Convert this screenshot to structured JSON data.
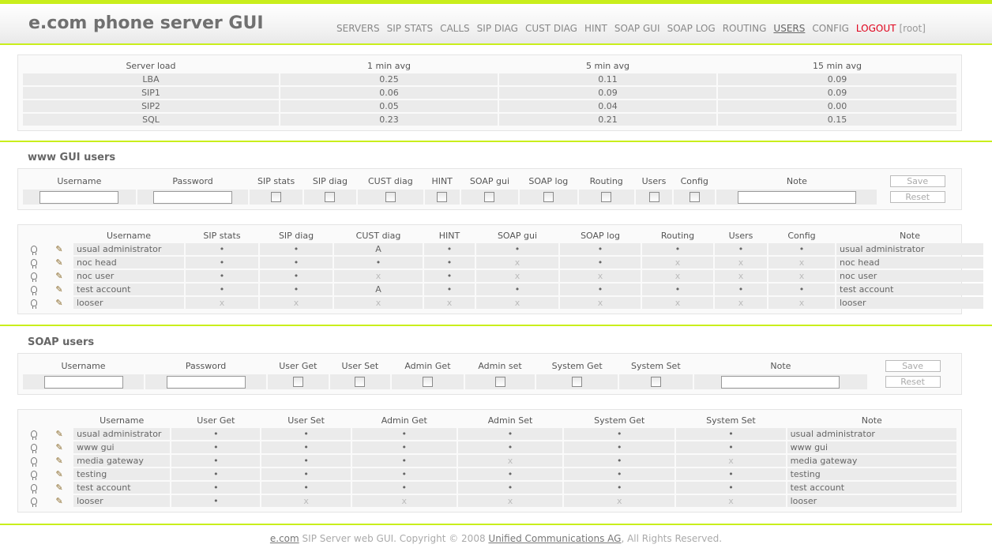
{
  "app": {
    "title": "e.com phone server GUI"
  },
  "nav": {
    "items": [
      "SERVERS",
      "SIP STATS",
      "CALLS",
      "SIP DIAG",
      "CUST DIAG",
      "HINT",
      "SOAP GUI",
      "SOAP LOG",
      "ROUTING",
      "USERS",
      "CONFIG"
    ],
    "active": "USERS",
    "logout": "LOGOUT",
    "user": "[root]"
  },
  "server_load": {
    "headers": [
      "Server load",
      "1 min avg",
      "5 min avg",
      "15 min avg"
    ],
    "rows": [
      [
        "LBA",
        "0.25",
        "0.11",
        "0.09"
      ],
      [
        "SIP1",
        "0.06",
        "0.09",
        "0.09"
      ],
      [
        "SIP2",
        "0.05",
        "0.04",
        "0.00"
      ],
      [
        "SQL",
        "0.23",
        "0.21",
        "0.15"
      ]
    ]
  },
  "www_users": {
    "title": "www GUI users",
    "form_headers": [
      "Username",
      "Password",
      "SIP stats",
      "SIP diag",
      "CUST diag",
      "HINT",
      "SOAP gui",
      "SOAP log",
      "Routing",
      "Users",
      "Config",
      "Note"
    ],
    "save_label": "Save",
    "reset_label": "Reset",
    "list_headers": [
      "Username",
      "SIP stats",
      "SIP diag",
      "CUST diag",
      "HINT",
      "SOAP gui",
      "SOAP log",
      "Routing",
      "Users",
      "Config",
      "Note"
    ],
    "rows": [
      [
        "usual administrator",
        "•",
        "•",
        "A",
        "•",
        "•",
        "•",
        "•",
        "•",
        "•",
        "usual administrator"
      ],
      [
        "noc head",
        "•",
        "•",
        "•",
        "•",
        "x",
        "•",
        "x",
        "x",
        "x",
        "noc head"
      ],
      [
        "noc user",
        "•",
        "•",
        "x",
        "•",
        "x",
        "x",
        "x",
        "x",
        "x",
        "noc user"
      ],
      [
        "test account",
        "•",
        "•",
        "A",
        "•",
        "•",
        "•",
        "•",
        "•",
        "•",
        "test account"
      ],
      [
        "looser",
        "x",
        "x",
        "x",
        "x",
        "x",
        "x",
        "x",
        "x",
        "x",
        "looser"
      ]
    ]
  },
  "soap_users": {
    "title": "SOAP users",
    "form_headers": [
      "Username",
      "Password",
      "User Get",
      "User Set",
      "Admin Get",
      "Admin set",
      "System Get",
      "System Set",
      "Note"
    ],
    "save_label": "Save",
    "reset_label": "Reset",
    "list_headers": [
      "Username",
      "User Get",
      "User Set",
      "Admin Get",
      "Admin Set",
      "System Get",
      "System Set",
      "Note"
    ],
    "rows": [
      [
        "usual administrator",
        "•",
        "•",
        "•",
        "•",
        "•",
        "•",
        "usual administrator"
      ],
      [
        "www gui",
        "•",
        "•",
        "•",
        "•",
        "•",
        "•",
        "www gui"
      ],
      [
        "media gateway",
        "•",
        "•",
        "•",
        "x",
        "•",
        "x",
        "media gateway"
      ],
      [
        "testing",
        "•",
        "•",
        "•",
        "•",
        "•",
        "•",
        "testing"
      ],
      [
        "test account",
        "•",
        "•",
        "•",
        "•",
        "•",
        "•",
        "test account"
      ],
      [
        "looser",
        "•",
        "x",
        "x",
        "x",
        "x",
        "x",
        "looser"
      ]
    ]
  },
  "footer": {
    "link1": "e.com",
    "text1": " SIP Server web GUI. Copyright © 2008 ",
    "link2": "Unified Communications AG",
    "text2": ", All Rights Reserved."
  },
  "icons": {
    "row_icon_1": "bulb-icon",
    "row_icon_2": "book-edit-icon"
  },
  "colors": {
    "accent": "#c9ee1c",
    "logout": "#e0001a"
  }
}
